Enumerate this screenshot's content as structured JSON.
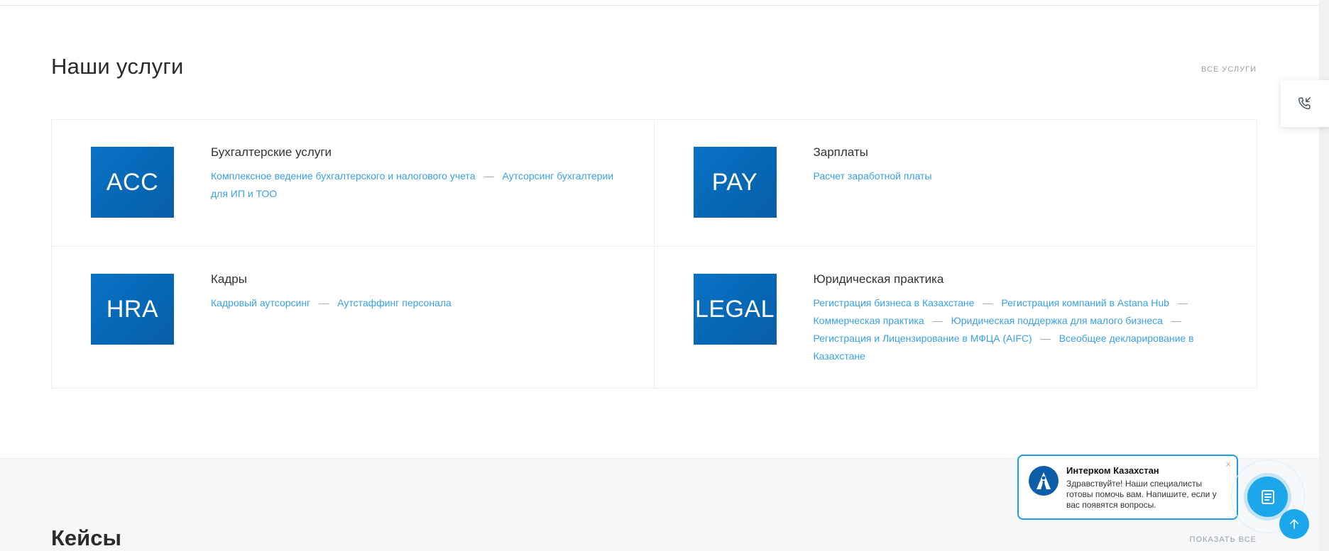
{
  "services": {
    "title": "Наши услуги",
    "all_link": "ВСЕ УСЛУГИ",
    "items": [
      {
        "code": "ACC",
        "title": "Бухгалтерские услуги",
        "links": [
          "Комплексное ведение бухгалтерского и налогового учета",
          "Аутсорсинг бухгалтерии для ИП и ТОО"
        ]
      },
      {
        "code": "PAY",
        "title": "Зарплаты",
        "links": [
          "Расчет заработной платы"
        ]
      },
      {
        "code": "HRA",
        "title": "Кадры",
        "links": [
          "Кадровый аутсорсинг",
          "Аутстаффинг персонала"
        ]
      },
      {
        "code": "LEGAL",
        "title": "Юридическая практика",
        "links": [
          "Регистрация бизнеса в Казахстане",
          "Регистрация компаний в Astana Hub",
          "Коммерческая практика",
          "Юридическая поддержка для малого бизнеса",
          "Регистрация и Лицензирование в МФЦА (AIFC)",
          "Всеобщее декларирование в Казахстане"
        ]
      }
    ],
    "separator": "—"
  },
  "cases": {
    "title": "Кейсы",
    "show_all": "ПОКАЗАТЬ ВСЕ"
  },
  "chat": {
    "name": "Интерком Казахстан",
    "message": "Здравствуйте! Наши специалисты готовы помочь вам. Напишите, если у вас появятся вопросы.",
    "close": "×"
  },
  "icons": {
    "call": "phone-callback-icon",
    "chat": "chat-icon",
    "up": "arrow-up-icon",
    "logo": "company-logo"
  },
  "colors": {
    "badge": "#0566b3",
    "link": "#3aa0e6",
    "accent": "#1ba7ea"
  }
}
